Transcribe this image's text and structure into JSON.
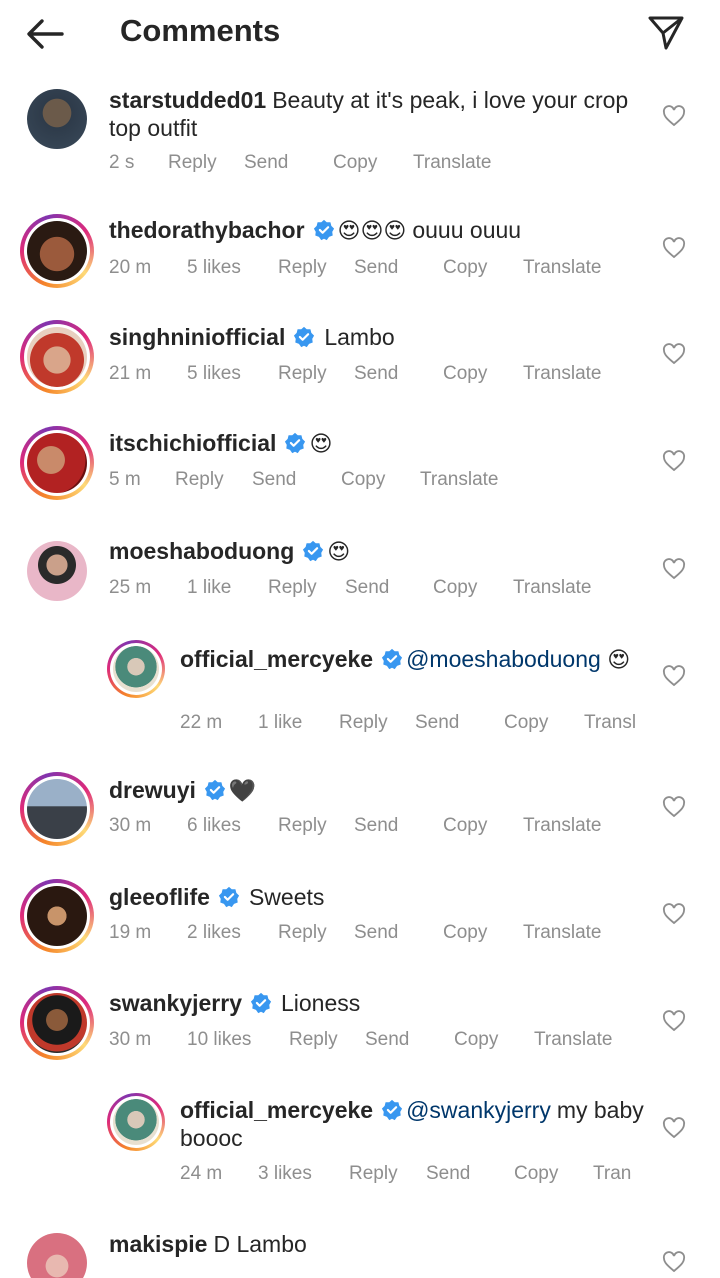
{
  "header": {
    "title": "Comments"
  },
  "actions": {
    "reply": "Reply",
    "send": "Send",
    "copy": "Copy",
    "translate": "Translate",
    "transl_trunc": "Transl",
    "tran_trunc": "Tran"
  },
  "comments": [
    {
      "user": "starstudded01",
      "text": "Beauty at it's peak, i love your crop",
      "text2": "top outfit",
      "time": "2 s"
    },
    {
      "user": "thedorathybachor",
      "emoji": "😍😍😍",
      "text": "ouuu ouuu",
      "time": "20 m",
      "likes": "5 likes"
    },
    {
      "user": "singhniniofficial",
      "text": "Lambo",
      "time": "21 m",
      "likes": "5 likes"
    },
    {
      "user": "itschichiofficial",
      "emoji": "😍",
      "time": "5 m"
    },
    {
      "user": "moeshaboduong",
      "emoji": "😍",
      "time": "25 m",
      "likes": "1 like"
    },
    {
      "user": "official_mercyeke",
      "mention": "@moeshaboduong",
      "emoji": "😍",
      "time": "22 m",
      "likes": "1 like"
    },
    {
      "user": "drewuyi",
      "emoji": "🖤",
      "time": "30 m",
      "likes": "6 likes"
    },
    {
      "user": "gleeoflife",
      "text": "Sweets",
      "time": "19 m",
      "likes": "2 likes"
    },
    {
      "user": "swankyjerry",
      "text": "Lioness",
      "time": "30 m",
      "likes": "10 likes"
    },
    {
      "user": "official_mercyeke",
      "mention": "@swankyjerry",
      "text": "my baby",
      "text2": "boooc",
      "time": "24 m",
      "likes": "3 likes"
    },
    {
      "user": "makispie",
      "text": "D Lambo"
    }
  ],
  "colors": {
    "verified": "#3897f0",
    "mention": "#00376b",
    "meta": "#8e8e8e"
  }
}
